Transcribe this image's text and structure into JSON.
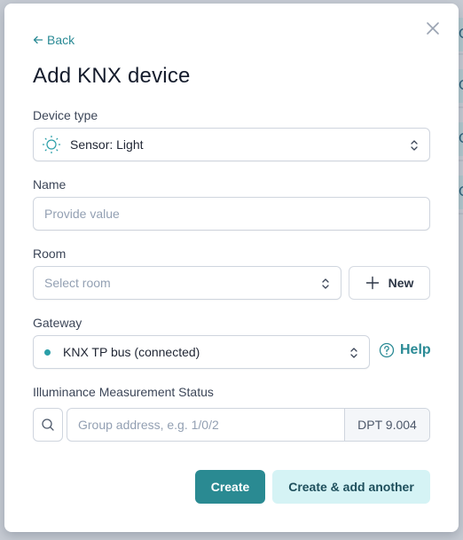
{
  "modal": {
    "back_label": "Back",
    "title": "Add KNX device",
    "close_icon": "close-icon"
  },
  "device_type": {
    "label": "Device type",
    "value": "Sensor: Light",
    "icon": "sun-icon"
  },
  "name": {
    "label": "Name",
    "value": "",
    "placeholder": "Provide value"
  },
  "room": {
    "label": "Room",
    "placeholder": "Select room",
    "new_button": "New"
  },
  "gateway": {
    "label": "Gateway",
    "value": "KNX TP bus (connected)",
    "status_color": "#2a9fa8",
    "help_label": "Help"
  },
  "illuminance": {
    "label": "Illuminance Measurement Status",
    "placeholder": "Group address, e.g. 1/0/2",
    "dpt": "DPT 9.004"
  },
  "actions": {
    "create": "Create",
    "create_another": "Create & add another"
  },
  "background": {
    "partial_letters": [
      "C",
      "C",
      "C",
      "C"
    ]
  },
  "colors": {
    "accent": "#2a8a92",
    "accent_light": "#d5f3f5"
  }
}
